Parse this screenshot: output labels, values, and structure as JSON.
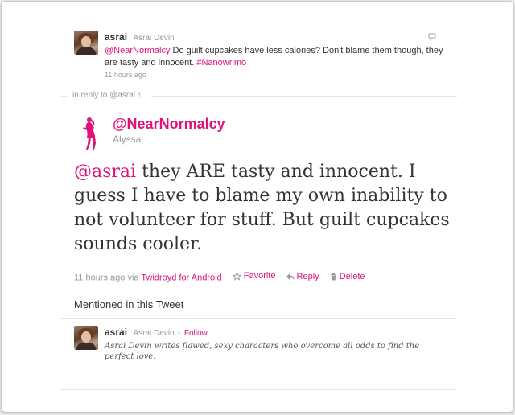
{
  "parent_tweet": {
    "screen_name": "asrai",
    "full_name": "Asrai Devin",
    "mention": "@NearNormalcy",
    "text": " Do guilt cupcakes have less calories? Don't blame them though, they are tasty and innocent. ",
    "hashtag": "#Nanowrimo",
    "timestamp": "11 hours ago"
  },
  "in_reply_to": "in reply to @asrai",
  "in_reply_arrow": "↑",
  "main_tweet": {
    "screen_name": "@NearNormalcy",
    "full_name": "Alyssa",
    "mention": "@asrai",
    "text": " they ARE tasty and innocent. I guess I have to blame my own inability to not volunteer for stuff. But guilt cupcakes sounds cooler.",
    "timestamp": "11 hours ago",
    "via_label": "via",
    "via_app": "Twidroyd for Android",
    "actions": {
      "favorite": "Favorite",
      "reply": "Reply",
      "delete": "Delete"
    }
  },
  "mentioned_heading": "Mentioned in this Tweet",
  "mentioned_user": {
    "screen_name": "asrai",
    "full_name": "Asrai Devin",
    "separator": "-",
    "follow_label": "Follow",
    "bio": "Asrai Devin writes flawed, sexy characters who overcome all odds to find the perfect love."
  },
  "colors": {
    "accent": "#e0127a",
    "muted": "#999999",
    "text": "#333333"
  },
  "icons": {
    "reply_toggle": "speech-bubble-icon",
    "main_avatar": "pink-silhouette-icon",
    "favorite": "star-icon",
    "reply": "reply-arrow-icon",
    "delete": "trash-icon"
  }
}
